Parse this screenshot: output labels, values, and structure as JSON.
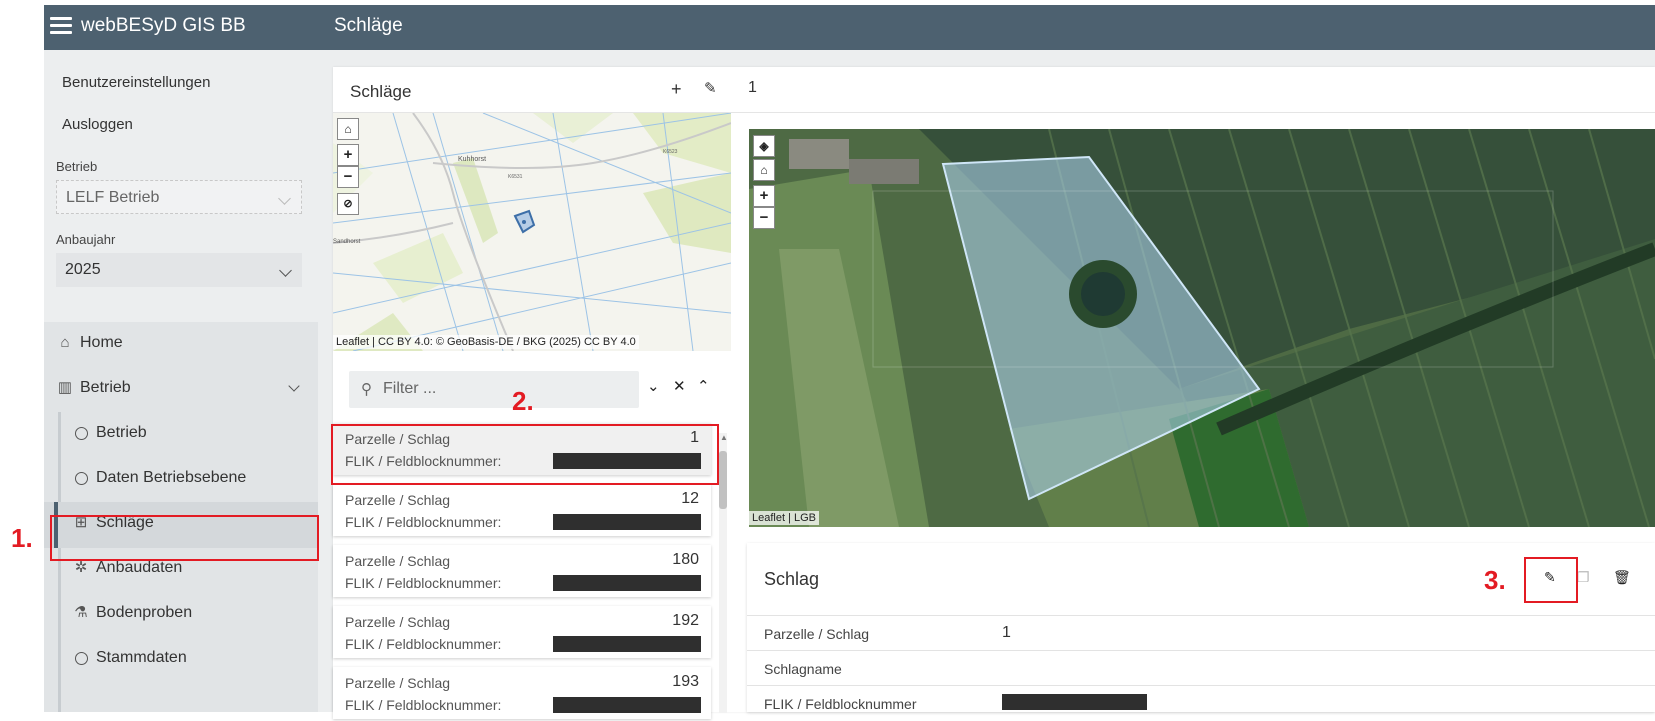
{
  "topbar": {
    "app_title": "webBESyD GIS BB",
    "page_title": "Schläge"
  },
  "sidebar": {
    "user_settings": "Benutzereinstellungen",
    "logout": "Ausloggen",
    "betrieb_label": "Betrieb",
    "betrieb_value": "LELF Betrieb",
    "year_label": "Anbaujahr",
    "year_value": "2025",
    "nav": {
      "home": "Home",
      "betrieb_group": "Betrieb",
      "betrieb": "Betrieb",
      "daten": "Daten Betriebsebene",
      "schlaege": "Schläge",
      "anbaudaten": "Anbaudaten",
      "bodenproben": "Bodenproben",
      "stammdaten": "Stammdaten"
    }
  },
  "panel": {
    "title": "Schläge",
    "selected_id": "1"
  },
  "small_map": {
    "attribution": "Leaflet | CC BY 4.0: © GeoBasis-DE / BKG (2025) CC BY 4.0",
    "place": "Kuhhorst",
    "place2": "Sandhorst",
    "road1": "K6531",
    "road2": "K6523"
  },
  "big_map": {
    "attribution": "Leaflet | LGB"
  },
  "filter": {
    "placeholder": "Filter ..."
  },
  "list": {
    "items": [
      {
        "label1": "Parzelle / Schlag",
        "label2": "FLIK / Feldblocknummer:",
        "num": "1"
      },
      {
        "label1": "Parzelle / Schlag",
        "label2": "FLIK / Feldblocknummer:",
        "num": "12"
      },
      {
        "label1": "Parzelle / Schlag",
        "label2": "FLIK / Feldblocknummer:",
        "num": "180"
      },
      {
        "label1": "Parzelle / Schlag",
        "label2": "FLIK / Feldblocknummer:",
        "num": "192"
      },
      {
        "label1": "Parzelle / Schlag",
        "label2": "FLIK / Feldblocknummer:",
        "num": "193"
      }
    ]
  },
  "detail": {
    "title": "Schlag",
    "rows": [
      {
        "key": "Parzelle / Schlag",
        "value": "1"
      },
      {
        "key": "Schlagname",
        "value": ""
      },
      {
        "key": "FLIK / Feldblocknummer",
        "value": ""
      }
    ]
  },
  "annotations": {
    "a1": "1.",
    "a2": "2.",
    "a3": "3."
  },
  "colors": {
    "topbar": "#4d6170",
    "annotation": "#e31b23",
    "sidebar": "#eceeef"
  }
}
